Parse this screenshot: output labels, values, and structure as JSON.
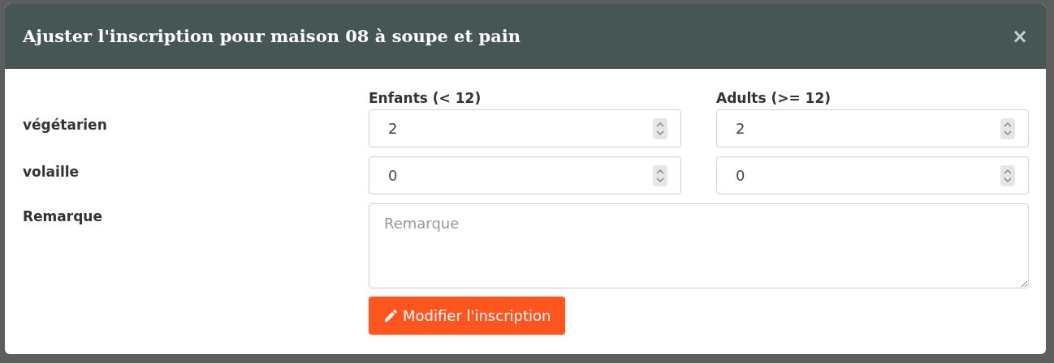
{
  "dialog": {
    "title": "Ajuster l'inscription pour maison 08 à soupe et pain",
    "close": "×",
    "columns": [
      "Enfants (< 12)",
      "Adults (>= 12)"
    ],
    "rows": [
      {
        "label": "végétarien",
        "values": [
          "2",
          "2"
        ]
      },
      {
        "label": "volaille",
        "values": [
          "0",
          "0"
        ]
      }
    ],
    "remark": {
      "label": "Remarque",
      "placeholder": "Remarque"
    },
    "submit": "Modifier l'inscription"
  }
}
